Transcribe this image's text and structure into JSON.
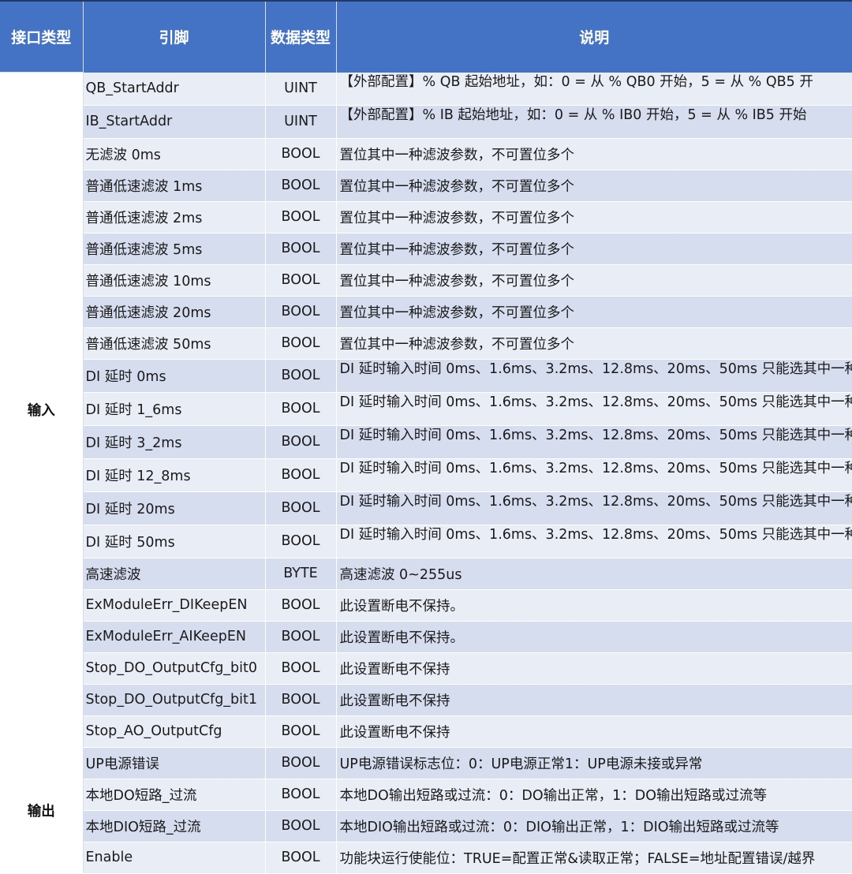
{
  "table": {
    "headers": [
      "接口类型",
      "引脚",
      "数据类型",
      "说明"
    ],
    "groups": [
      {
        "label": "输入",
        "rows": [
          {
            "pin": "QB_StartAddr",
            "type": "UINT",
            "desc": "【外部配置】% QB 起始地址，如：0 = 从 % QB0 开始，5 = 从 % QB5 开"
          },
          {
            "pin": "IB_StartAddr",
            "type": "UINT",
            "desc": "【外部配置】% IB 起始地址，如：0 = 从 % IB0 开始，5 = 从 % IB5 开始"
          },
          {
            "pin": "无滤波 0ms",
            "type": "BOOL",
            "desc": "置位其中一种滤波参数，不可置位多个"
          },
          {
            "pin": "普通低速滤波 1ms",
            "type": "BOOL",
            "desc": "置位其中一种滤波参数，不可置位多个"
          },
          {
            "pin": "普通低速滤波 2ms",
            "type": "BOOL",
            "desc": "置位其中一种滤波参数，不可置位多个"
          },
          {
            "pin": "普通低速滤波 5ms",
            "type": "BOOL",
            "desc": "置位其中一种滤波参数，不可置位多个"
          },
          {
            "pin": "普通低速滤波 10ms",
            "type": "BOOL",
            "desc": "置位其中一种滤波参数，不可置位多个"
          },
          {
            "pin": "普通低速滤波 20ms",
            "type": "BOOL",
            "desc": "置位其中一种滤波参数，不可置位多个"
          },
          {
            "pin": "普通低速滤波 50ms",
            "type": "BOOL",
            "desc": "置位其中一种滤波参数，不可置位多个"
          },
          {
            "pin": "DI 延时 0ms",
            "type": "BOOL",
            "desc": "DI 延时输入时间 0ms、1.6ms、3.2ms、12.8ms、20ms、50ms 只能选其中一种"
          },
          {
            "pin": "DI 延时 1_6ms",
            "type": "BOOL",
            "desc": "DI 延时输入时间 0ms、1.6ms、3.2ms、12.8ms、20ms、50ms 只能选其中一种"
          },
          {
            "pin": "DI 延时 3_2ms",
            "type": "BOOL",
            "desc": "DI 延时输入时间 0ms、1.6ms、3.2ms、12.8ms、20ms、50ms 只能选其中一种"
          },
          {
            "pin": "DI 延时 12_8ms",
            "type": "BOOL",
            "desc": "DI 延时输入时间 0ms、1.6ms、3.2ms、12.8ms、20ms、50ms 只能选其中一种"
          },
          {
            "pin": "DI 延时 20ms",
            "type": "BOOL",
            "desc": "DI 延时输入时间 0ms、1.6ms、3.2ms、12.8ms、20ms、50ms 只能选其中一种"
          },
          {
            "pin": "DI 延时 50ms",
            "type": "BOOL",
            "desc": "DI 延时输入时间 0ms、1.6ms、3.2ms、12.8ms、20ms、50ms 只能选其中一种"
          },
          {
            "pin": "高速滤波",
            "type": "BYTE",
            "desc": "高速滤波 0~255us"
          },
          {
            "pin": "ExModuleErr_DIKeepEN",
            "type": "BOOL",
            "desc": "此设置断电不保持。"
          },
          {
            "pin": "ExModuleErr_AIKeepEN",
            "type": "BOOL",
            "desc": "此设置断电不保持。"
          },
          {
            "pin": "Stop_DO_OutputCfg_bit0",
            "type": "BOOL",
            "desc": "此设置断电不保持"
          },
          {
            "pin": "Stop_DO_OutputCfg_bit1",
            "type": "BOOL",
            "desc": "此设置断电不保持"
          },
          {
            "pin": "Stop_AO_OutputCfg",
            "type": "BOOL",
            "desc": "此设置断电不保持"
          }
        ]
      },
      {
        "label": "输出",
        "rows": [
          {
            "pin": "UP电源错误",
            "type": "BOOL",
            "desc": "UP电源错误标志位：0：UP电源正常1：UP电源未接或异常"
          },
          {
            "pin": "本地DO短路_过流",
            "type": "BOOL",
            "desc": "本地DO输出短路或过流：0：DO输出正常，1：DO输出短路或过流等"
          },
          {
            "pin": "本地DIO短路_过流",
            "type": "BOOL",
            "desc": "本地DIO输出短路或过流：0：DIO输出正常，1：DIO输出短路或过流等"
          },
          {
            "pin": "Enable",
            "type": "BOOL",
            "desc": "功能块运行使能位：TRUE=配置正常&读取正常；FALSE=地址配置错误/越界"
          }
        ]
      }
    ]
  }
}
